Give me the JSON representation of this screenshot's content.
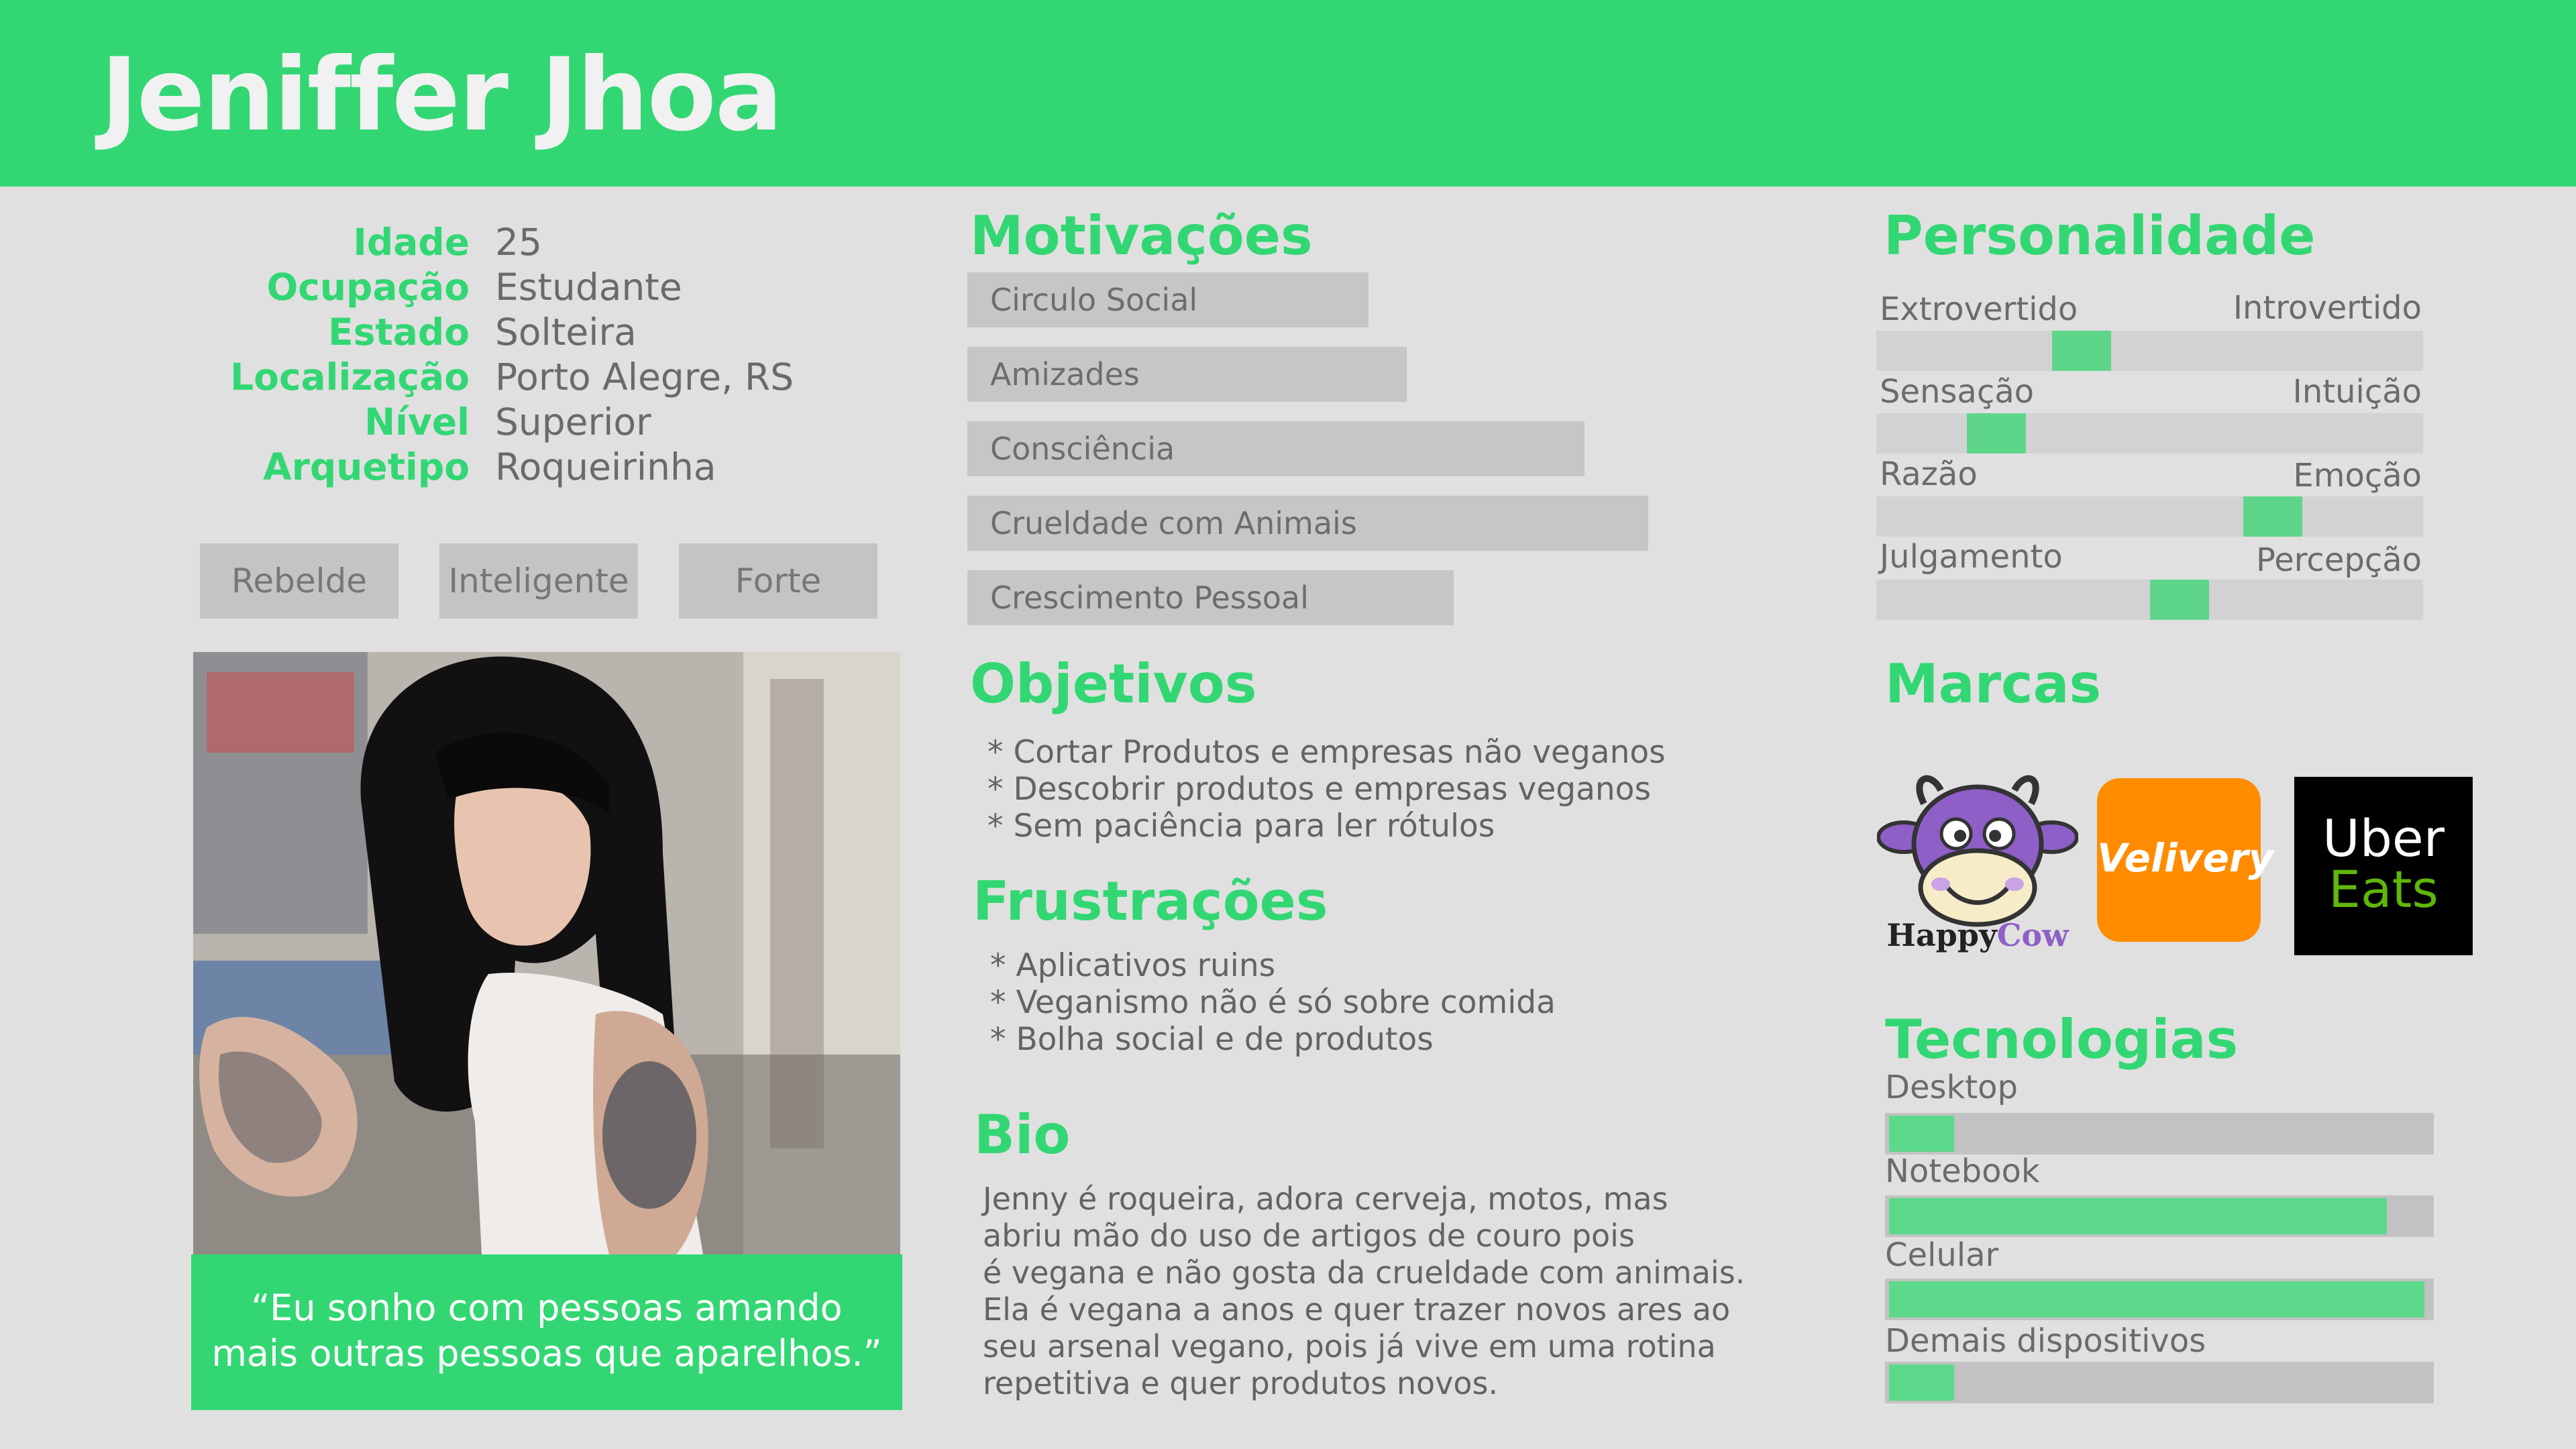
{
  "persona": {
    "name": "Jeniffer Jhoa",
    "info": [
      {
        "label": "Idade",
        "value": "25"
      },
      {
        "label": "Ocupação",
        "value": "Estudante"
      },
      {
        "label": "Estado",
        "value": "Solteira"
      },
      {
        "label": "Localização",
        "value": "Porto Alegre, RS"
      },
      {
        "label": "Nível",
        "value": "Superior"
      },
      {
        "label": "Arquetipo",
        "value": "Roqueirinha"
      }
    ],
    "traits": [
      "Rebelde",
      "Inteligente",
      "Forte"
    ],
    "quote_line1": "“Eu sonho com pessoas amando",
    "quote_line2": "mais outras pessoas que aparelhos.”"
  },
  "motivacoes": {
    "title": "Motivações",
    "items": [
      {
        "label": "Circulo Social",
        "level": 0.39
      },
      {
        "label": "Amizades",
        "level": 0.43
      },
      {
        "label": "Consciência",
        "level": 0.6
      },
      {
        "label": "Crueldade com Animais",
        "level": 0.66
      },
      {
        "label": "Crescimento Pessoal",
        "level": 0.47
      }
    ]
  },
  "objetivos": {
    "title": "Objetivos",
    "items": [
      "* Cortar Produtos e empresas não veganos",
      "* Descobrir produtos e empresas veganos",
      "* Sem paciência para ler rótulos"
    ]
  },
  "frustracoes": {
    "title": "Frustrações",
    "items": [
      "* Aplicativos ruins",
      "* Veganismo não é só sobre comida",
      "* Bolha social e de produtos"
    ]
  },
  "bio": {
    "title": "Bio",
    "lines": [
      "Jenny é roqueira, adora cerveja, motos, mas",
      "abriu mão do uso de artigos de couro pois",
      "é vegana e não gosta da crueldade com animais.",
      "Ela é vegana a anos e quer trazer novos ares ao",
      "seu arsenal vegano, pois já vive em uma rotina",
      "repetitiva e quer produtos novos."
    ]
  },
  "personalidade": {
    "title": "Personalidade",
    "scales": [
      {
        "left": "Extrovertido",
        "right": "Introvertido",
        "position": 0.375
      },
      {
        "left": "Sensação",
        "right": "Intuição",
        "position": 0.22
      },
      {
        "left": "Razão",
        "right": "Emoção",
        "position": 0.725
      },
      {
        "left": "Julgamento",
        "right": "Percepção",
        "position": 0.555
      }
    ]
  },
  "marcas": {
    "title": "Marcas",
    "brands": [
      {
        "name": "HappyCow",
        "word1": "Happy",
        "word2": "Cow"
      },
      {
        "name": "Velivery",
        "text": "Velivery",
        "color": "#ff8c00"
      },
      {
        "name": "Uber Eats",
        "word1": "Uber",
        "word2": "Eats",
        "color": "#5fb709"
      }
    ]
  },
  "tecnologias": {
    "title": "Tecnologias",
    "items": [
      {
        "label": "Desktop",
        "level": 0.12
      },
      {
        "label": "Notebook",
        "level": 0.92
      },
      {
        "label": "Celular",
        "level": 0.99
      },
      {
        "label": "Demais dispositivos",
        "level": 0.12
      }
    ]
  },
  "colors": {
    "accent": "#32d773",
    "background": "#e0e0e0",
    "bar": "#c6c6c6",
    "marker": "#5ed68a"
  }
}
